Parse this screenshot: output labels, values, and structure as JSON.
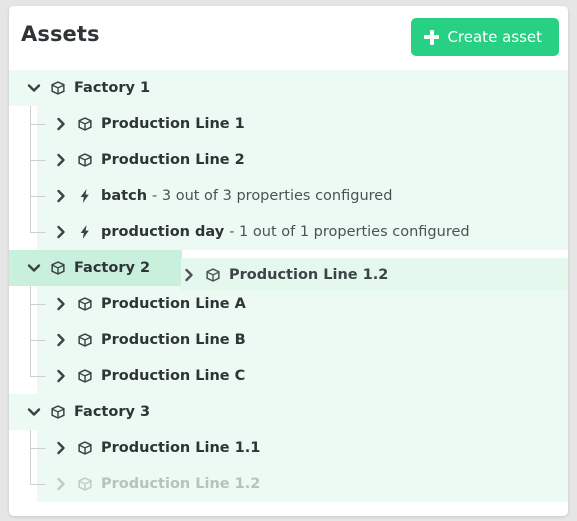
{
  "header": {
    "title": "Assets",
    "create_button": {
      "label": "Create asset",
      "icon": "plus-icon"
    },
    "accent_color": "#27d083"
  },
  "colors": {
    "row_background": "#ecfaf3",
    "drop_target_background": "#c9f0dd",
    "drag_ghost_background": "#e4f8ee",
    "card_background": "#ffffff",
    "page_background": "#e6e6e6",
    "text": "#2f3437",
    "muted_text": "#4b5356",
    "faded_text": "#b9c0bd",
    "guide_line": "#cfcfcf"
  },
  "tree": {
    "rows": [
      {
        "label": "Factory 1",
        "suffix": "",
        "level": 0,
        "icon": "cube-icon",
        "chevron": "chevron-down-icon",
        "expanded": true,
        "state": "normal"
      },
      {
        "label": "Production Line 1",
        "suffix": "",
        "level": 1,
        "icon": "cube-icon",
        "chevron": "chevron-right-icon",
        "expanded": false,
        "state": "normal"
      },
      {
        "label": "Production Line 2",
        "suffix": "",
        "level": 1,
        "icon": "cube-icon",
        "chevron": "chevron-right-icon",
        "expanded": false,
        "state": "normal"
      },
      {
        "label": "batch",
        "suffix": "- 3 out of 3 properties configured",
        "level": 1,
        "icon": "lightning-bolt-icon",
        "chevron": "chevron-right-icon",
        "expanded": false,
        "state": "normal"
      },
      {
        "label": "production day",
        "suffix": "- 1 out of 1 properties configured",
        "level": 1,
        "icon": "lightning-bolt-icon",
        "chevron": "chevron-right-icon",
        "expanded": false,
        "state": "normal"
      },
      {
        "label": "Factory 2",
        "suffix": "",
        "level": 0,
        "icon": "cube-icon",
        "chevron": "chevron-down-icon",
        "expanded": true,
        "state": "drop-target"
      },
      {
        "label": "Production Line A",
        "suffix": "",
        "level": 1,
        "icon": "cube-icon",
        "chevron": "chevron-right-icon",
        "expanded": false,
        "state": "normal"
      },
      {
        "label": "Production Line B",
        "suffix": "",
        "level": 1,
        "icon": "cube-icon",
        "chevron": "chevron-right-icon",
        "expanded": false,
        "state": "normal"
      },
      {
        "label": "Production Line C",
        "suffix": "",
        "level": 1,
        "icon": "cube-icon",
        "chevron": "chevron-right-icon",
        "expanded": false,
        "state": "normal"
      },
      {
        "label": "Factory 3",
        "suffix": "",
        "level": 0,
        "icon": "cube-icon",
        "chevron": "chevron-down-icon",
        "expanded": true,
        "state": "normal"
      },
      {
        "label": "Production Line 1.1",
        "suffix": "",
        "level": 1,
        "icon": "cube-icon",
        "chevron": "chevron-right-icon",
        "expanded": false,
        "state": "normal"
      },
      {
        "label": "Production Line 1.2",
        "suffix": "",
        "level": 1,
        "icon": "cube-icon",
        "chevron": "chevron-right-icon",
        "expanded": false,
        "state": "dragging"
      }
    ]
  },
  "drag_ghost": {
    "label": "Production Line 1.2",
    "icon": "cube-icon",
    "chevron": "chevron-right-icon"
  }
}
